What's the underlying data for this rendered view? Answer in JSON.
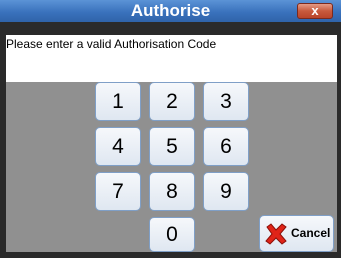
{
  "window": {
    "title": "Authorise",
    "close_label": "x"
  },
  "message": "Please enter a valid Authorisation Code",
  "keypad": {
    "keys": [
      "1",
      "2",
      "3",
      "4",
      "5",
      "6",
      "7",
      "8",
      "9",
      "0"
    ]
  },
  "cancel": {
    "label": "Cancel",
    "icon": "red-x-icon"
  },
  "colors": {
    "titlebar": "#3a72bd",
    "panel": "#909090",
    "cancel_icon": "#e02418"
  }
}
